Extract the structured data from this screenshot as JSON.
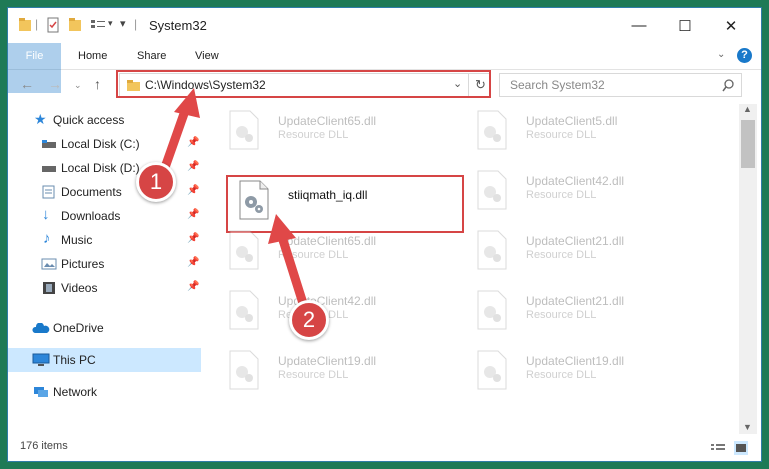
{
  "window": {
    "title": "System32",
    "controls": {
      "minimize": "—",
      "maximize": "☐",
      "close": "✕"
    }
  },
  "ribbon": {
    "tabs": [
      "File",
      "Home",
      "Share",
      "View"
    ],
    "help": "?"
  },
  "navigation": {
    "address": "C:\\Windows\\System32",
    "search_placeholder": "Search System32"
  },
  "sidebar": {
    "items": [
      {
        "label": "Quick access",
        "icon": "star-icon",
        "pinned": false
      },
      {
        "label": "Local Disk (C:)",
        "icon": "drive-icon",
        "pinned": true
      },
      {
        "label": "Local Disk (D:)",
        "icon": "drive-icon",
        "pinned": true
      },
      {
        "label": "Documents",
        "icon": "documents-icon",
        "pinned": true
      },
      {
        "label": "Downloads",
        "icon": "downloads-icon",
        "pinned": true
      },
      {
        "label": "Music",
        "icon": "music-icon",
        "pinned": true
      },
      {
        "label": "Pictures",
        "icon": "pictures-icon",
        "pinned": true
      },
      {
        "label": "Videos",
        "icon": "videos-icon",
        "pinned": true
      },
      {
        "label": "OneDrive",
        "icon": "cloud-icon",
        "pinned": false
      },
      {
        "label": "This PC",
        "icon": "computer-icon",
        "pinned": false,
        "selected": true
      },
      {
        "label": "Network",
        "icon": "network-icon",
        "pinned": false
      }
    ]
  },
  "files": {
    "focus": {
      "name": "stiiqmath_iq.dll"
    },
    "left_column": [
      {
        "name": "UpdateClient65.dll",
        "type": "Resource DLL"
      },
      {
        "name": "UpdateClient65.dll",
        "type": "Resource DLL"
      },
      {
        "name": "UpdateClient42.dll",
        "type": "Resource DLL"
      },
      {
        "name": "UpdateClient19.dll",
        "type": "Resource DLL"
      }
    ],
    "right_column": [
      {
        "name": "UpdateClient5.dll",
        "type": "Resource DLL"
      },
      {
        "name": "UpdateClient42.dll",
        "type": "Resource DLL"
      },
      {
        "name": "UpdateClient21.dll",
        "type": "Resource DLL"
      },
      {
        "name": "UpdateClient21.dll",
        "type": "Resource DLL"
      },
      {
        "name": "UpdateClient19.dll",
        "type": "Resource DLL"
      }
    ]
  },
  "status": {
    "item_count": "176 items"
  },
  "annotations": {
    "step1": "1",
    "step2": "2"
  },
  "colors": {
    "accent": "#1979ca",
    "highlight": "#d64545",
    "selection": "#cce8ff",
    "background": "#1e7a56"
  }
}
